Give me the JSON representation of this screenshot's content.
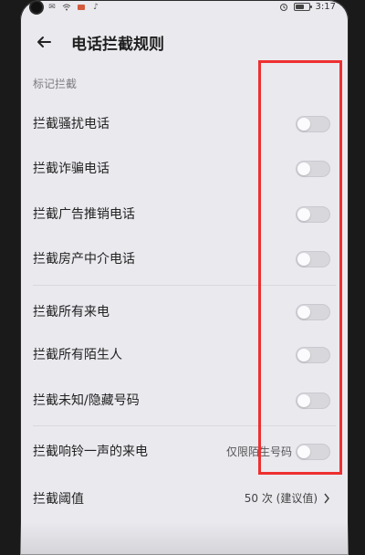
{
  "status_bar": {
    "time": "3:17",
    "left_icons": [
      "camera-hole",
      "message-icon",
      "wifi-icon",
      "notification-icon",
      "tiktok-icon"
    ],
    "right_icons": [
      "alarm-icon",
      "battery-icon"
    ],
    "battery_level": 0.65
  },
  "header": {
    "title": "电话拦截规则",
    "back_icon": "arrow-left-icon"
  },
  "section": {
    "label": "标记拦截"
  },
  "rules": [
    {
      "label": "拦截骚扰电话",
      "enabled": false
    },
    {
      "label": "拦截诈骗电话",
      "enabled": false
    },
    {
      "label": "拦截广告推销电话",
      "enabled": false
    },
    {
      "label": "拦截房产中介电话",
      "enabled": false
    },
    {
      "label": "拦截所有来电",
      "enabled": false
    },
    {
      "label": "拦截所有陌生人",
      "enabled": false
    },
    {
      "label": "拦截未知/隐藏号码",
      "enabled": false
    },
    {
      "label": "拦截响铃一声的来电",
      "hint": "仅限陌生号码",
      "enabled": false
    }
  ],
  "threshold": {
    "label": "拦截阈值",
    "value": "50 次 (建议值)",
    "chevron": "chevron-right-icon"
  },
  "colors": {
    "background": "#eae9ee",
    "highlight": "#ee2f2f",
    "toggle_off": "#d7d7dc",
    "text": "#222222"
  }
}
